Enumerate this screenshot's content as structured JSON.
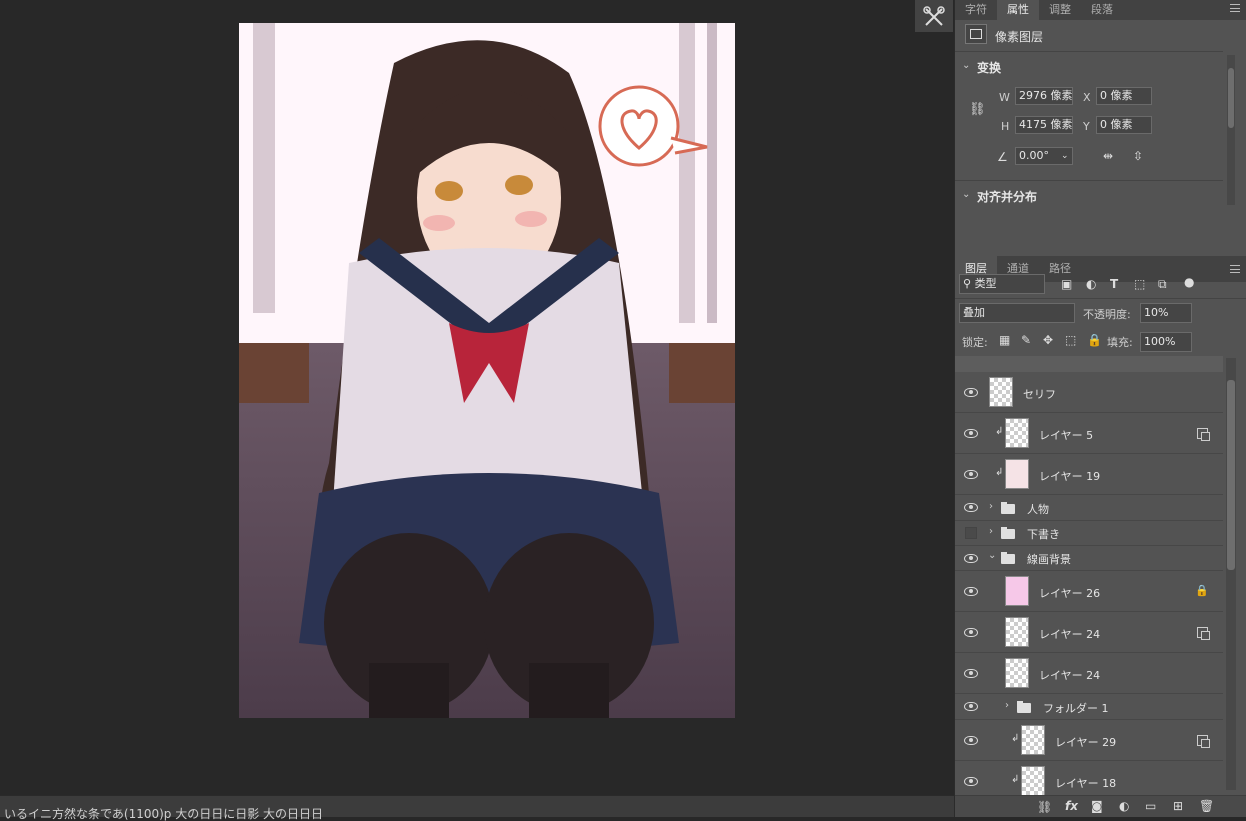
{
  "status_bar": {
    "text": "いるイニ方然な条であ(1100)p       大の日日に日影       大の日日日"
  },
  "tool_strip": {
    "icon": "tools-icon"
  },
  "properties": {
    "tabs": [
      "字符",
      "属性",
      "调整",
      "段落"
    ],
    "active_tab": "属性",
    "layer_type": "像素图层",
    "transform_title": "变换",
    "w_label": "W",
    "w_value": "2976 像素",
    "h_label": "H",
    "h_value": "4175 像素",
    "x_label": "X",
    "x_value": "0 像素",
    "y_label": "Y",
    "y_value": "0 像素",
    "angle_value": "0.00°",
    "align_title": "对齐并分布"
  },
  "layers_panel": {
    "tabs": [
      "图层",
      "通道",
      "路径"
    ],
    "active_tab": "图层",
    "filter_kind": "类型",
    "blend_mode": "叠加",
    "opacity_label": "不透明度:",
    "opacity_value": "10%",
    "lock_label": "锁定:",
    "fill_label": "填充:",
    "fill_value": "100%",
    "layers": [
      {
        "name": "セリフ",
        "visible": true,
        "type": "pixel"
      },
      {
        "name": "レイヤー 5",
        "visible": true,
        "type": "pixel",
        "clipped": true,
        "linked": true
      },
      {
        "name": "レイヤー 19",
        "visible": true,
        "type": "pixel",
        "clipped": true,
        "thumb_color": "#f5e3e6"
      },
      {
        "name": "人物",
        "visible": true,
        "type": "group"
      },
      {
        "name": "下書き",
        "visible": false,
        "type": "group"
      },
      {
        "name": "線画背景",
        "visible": true,
        "type": "group",
        "expanded": true
      },
      {
        "name": "レイヤー 26",
        "visible": true,
        "type": "pixel",
        "locked": true,
        "thumb_color": "#f6c8e8"
      },
      {
        "name": "レイヤー 24",
        "visible": true,
        "type": "pixel",
        "linked": true
      },
      {
        "name": "レイヤー 24",
        "visible": true,
        "type": "pixel"
      },
      {
        "name": "フォルダー 1",
        "visible": true,
        "type": "group"
      },
      {
        "name": "レイヤー 29",
        "visible": true,
        "type": "pixel",
        "clipped": true,
        "linked": true
      },
      {
        "name": "レイヤー 18",
        "visible": true,
        "type": "pixel",
        "clipped": true
      }
    ],
    "footer_icons": [
      "link-icon",
      "fx-icon",
      "mask-icon",
      "adjustment-icon",
      "folder-icon",
      "new-layer-icon",
      "trash-icon"
    ]
  },
  "colors": {
    "panel": "#535353",
    "canvas_bg": "#282828",
    "bubble": "#d76a55"
  }
}
